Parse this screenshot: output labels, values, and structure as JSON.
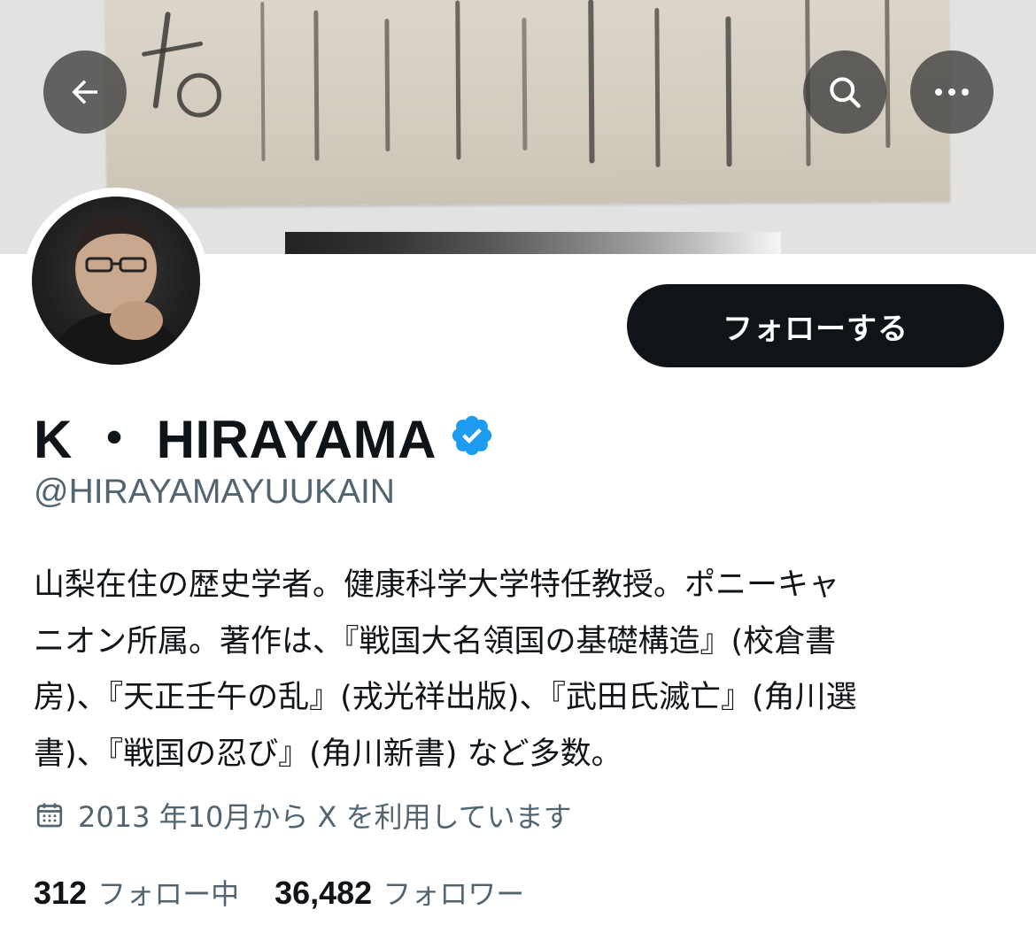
{
  "header": {
    "back_icon": "arrow-left-icon",
    "search_icon": "search-icon",
    "more_icon": "more-horizontal-icon"
  },
  "profile": {
    "follow_label": "フォローする",
    "display_name": "K ・ HIRAYAMA",
    "verified_icon": "verified-badge-icon",
    "verified_color": "#1d9bf0",
    "handle": "@HIRAYAMAYUUKAIN",
    "bio": "山梨在住の歴史学者。健康科学大学特任教授。ポニーキャ\nニオン所属。著作は、『戦国大名領国の基礎構造』(校倉書\n房)、『天正壬午の乱』(戎光祥出版)、『武田氏滅亡』(角川選\n書)、『戦国の忍び』(角川新書) など多数。",
    "joined_icon": "calendar-icon",
    "joined_text": "2013 年10月から X を利用しています",
    "following_count": "312",
    "following_label": "フォロー中",
    "followers_count": "36,482",
    "followers_label": "フォロワー"
  },
  "colors": {
    "text_primary": "#0f1419",
    "text_secondary": "#536471",
    "button_dark": "#0f1419"
  }
}
